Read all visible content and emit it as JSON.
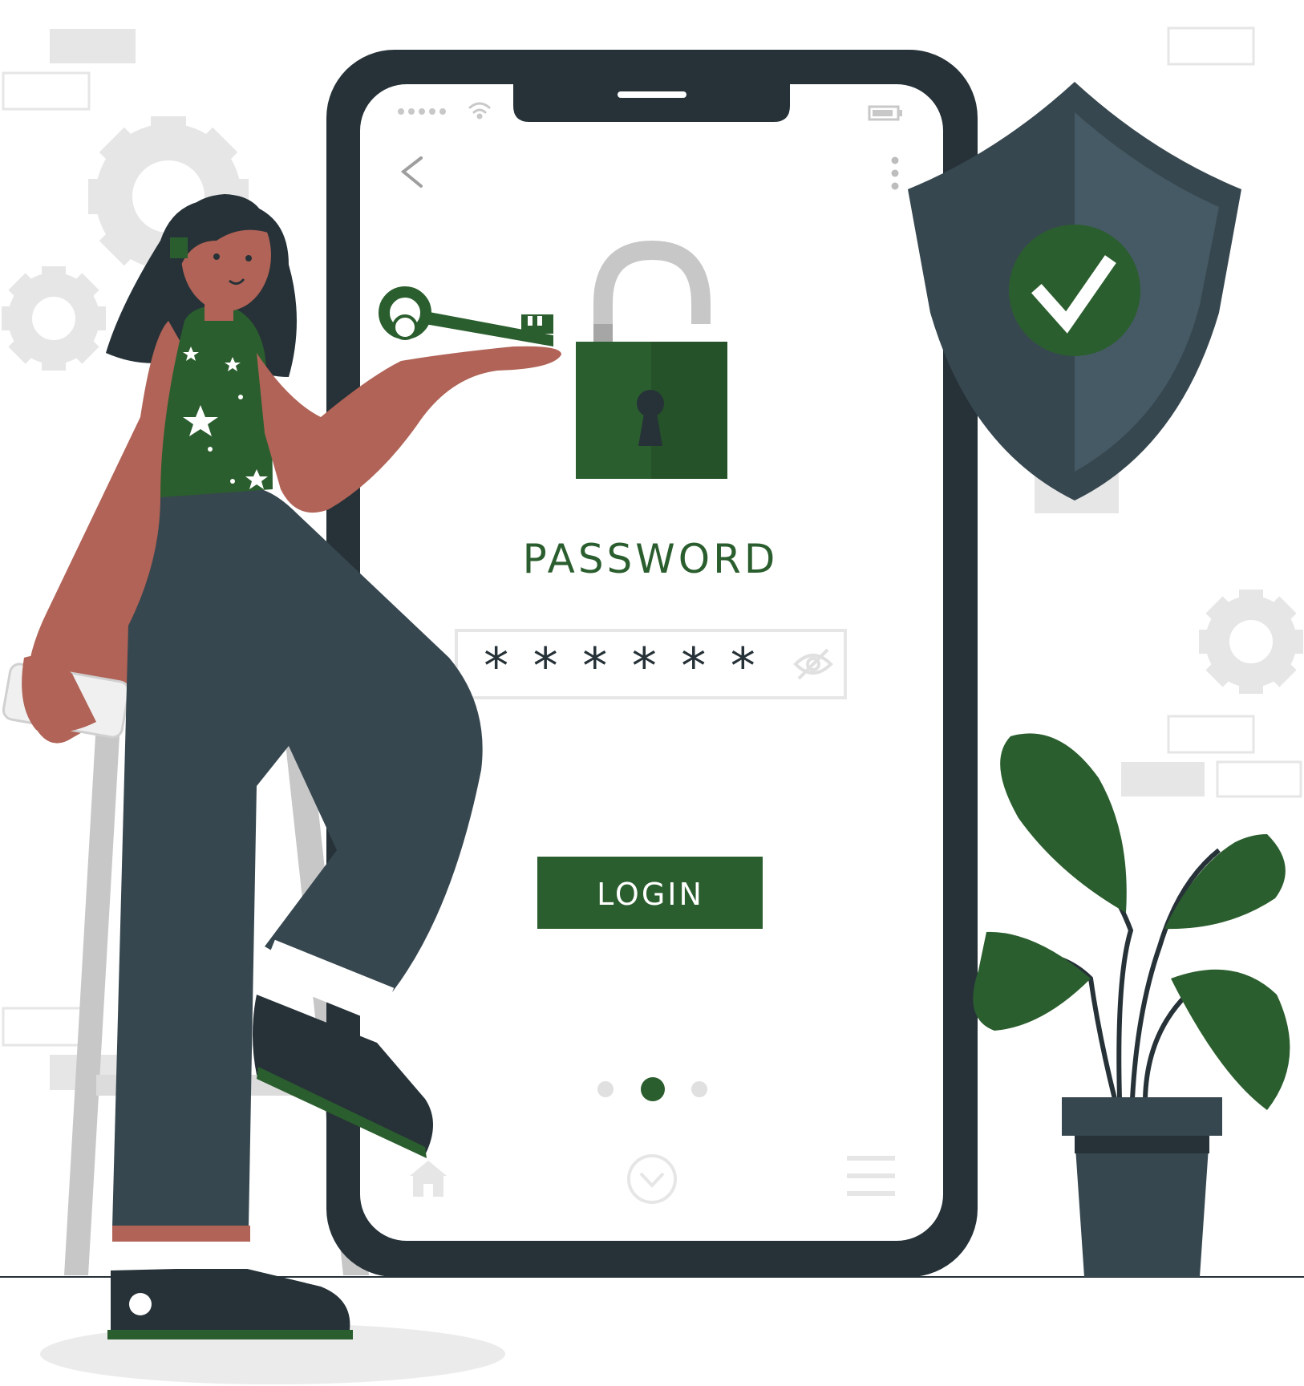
{
  "screen": {
    "password_heading": "PASSWORD",
    "password_value": "******",
    "login_button_label": "LOGIN",
    "carousel": {
      "count": 3,
      "active_index": 1
    }
  },
  "icons": {
    "status_bar": [
      "signal-dots-icon",
      "wifi-icon",
      "battery-icon"
    ],
    "top_bar": [
      "back-arrow-icon",
      "more-vertical-icon"
    ],
    "field": [
      "eye-icon"
    ],
    "bottom_nav": [
      "home-icon",
      "chevron-down-circle-icon",
      "menu-icon"
    ],
    "decor": [
      "padlock-icon",
      "key-icon",
      "shield-check-icon",
      "gear-icon",
      "plant-icon"
    ]
  },
  "colors": {
    "brand_green": "#2b5e2e",
    "dark": "#263238",
    "shield": "#37474f",
    "skin": "#b06356",
    "grey_decor": "#e6e6e6"
  }
}
